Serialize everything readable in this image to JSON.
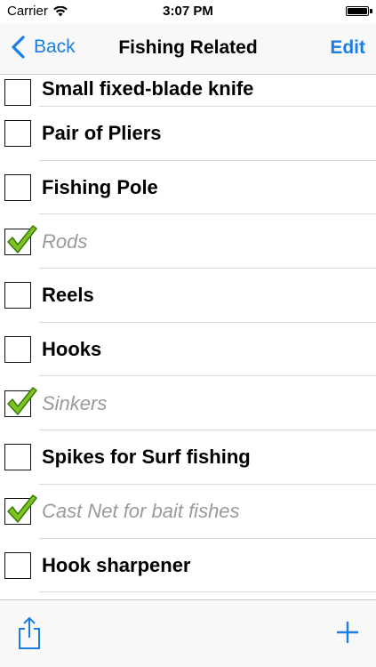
{
  "status_bar": {
    "carrier": "Carrier",
    "time": "3:07 PM"
  },
  "nav": {
    "back_label": "Back",
    "title": "Fishing Related",
    "edit_label": "Edit"
  },
  "items": [
    {
      "label": "Small fixed-blade knife",
      "checked": false
    },
    {
      "label": "Pair of Pliers",
      "checked": false
    },
    {
      "label": "Fishing Pole",
      "checked": false
    },
    {
      "label": "Rods",
      "checked": true
    },
    {
      "label": "Reels",
      "checked": false
    },
    {
      "label": "Hooks",
      "checked": false
    },
    {
      "label": "Sinkers",
      "checked": true
    },
    {
      "label": "Spikes for Surf fishing",
      "checked": false
    },
    {
      "label": "Cast Net for bait fishes",
      "checked": true
    },
    {
      "label": "Hook sharpener",
      "checked": false
    }
  ],
  "colors": {
    "accent": "#1a7ee6",
    "checkmark": "#7cc41f",
    "done_text": "#9a9a9a"
  },
  "icons": {
    "back": "chevron-left-icon",
    "share": "share-icon",
    "add": "plus-icon",
    "wifi": "wifi-icon",
    "battery": "battery-icon",
    "check": "checkmark-icon"
  }
}
